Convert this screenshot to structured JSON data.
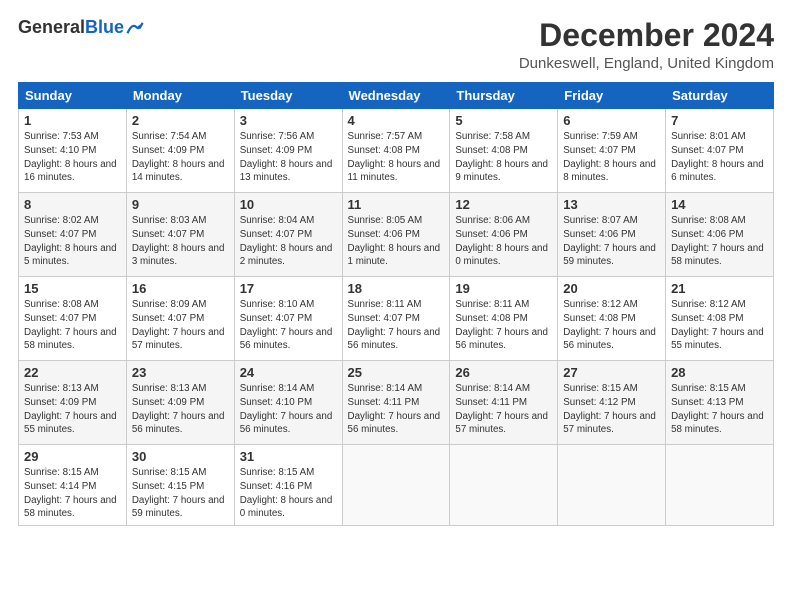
{
  "logo": {
    "general": "General",
    "blue": "Blue"
  },
  "header": {
    "month": "December 2024",
    "location": "Dunkeswell, England, United Kingdom"
  },
  "weekdays": [
    "Sunday",
    "Monday",
    "Tuesday",
    "Wednesday",
    "Thursday",
    "Friday",
    "Saturday"
  ],
  "weeks": [
    [
      {
        "day": "1",
        "sunrise": "7:53 AM",
        "sunset": "4:10 PM",
        "daylight": "8 hours and 16 minutes."
      },
      {
        "day": "2",
        "sunrise": "7:54 AM",
        "sunset": "4:09 PM",
        "daylight": "8 hours and 14 minutes."
      },
      {
        "day": "3",
        "sunrise": "7:56 AM",
        "sunset": "4:09 PM",
        "daylight": "8 hours and 13 minutes."
      },
      {
        "day": "4",
        "sunrise": "7:57 AM",
        "sunset": "4:08 PM",
        "daylight": "8 hours and 11 minutes."
      },
      {
        "day": "5",
        "sunrise": "7:58 AM",
        "sunset": "4:08 PM",
        "daylight": "8 hours and 9 minutes."
      },
      {
        "day": "6",
        "sunrise": "7:59 AM",
        "sunset": "4:07 PM",
        "daylight": "8 hours and 8 minutes."
      },
      {
        "day": "7",
        "sunrise": "8:01 AM",
        "sunset": "4:07 PM",
        "daylight": "8 hours and 6 minutes."
      }
    ],
    [
      {
        "day": "8",
        "sunrise": "8:02 AM",
        "sunset": "4:07 PM",
        "daylight": "8 hours and 5 minutes."
      },
      {
        "day": "9",
        "sunrise": "8:03 AM",
        "sunset": "4:07 PM",
        "daylight": "8 hours and 3 minutes."
      },
      {
        "day": "10",
        "sunrise": "8:04 AM",
        "sunset": "4:07 PM",
        "daylight": "8 hours and 2 minutes."
      },
      {
        "day": "11",
        "sunrise": "8:05 AM",
        "sunset": "4:06 PM",
        "daylight": "8 hours and 1 minute."
      },
      {
        "day": "12",
        "sunrise": "8:06 AM",
        "sunset": "4:06 PM",
        "daylight": "8 hours and 0 minutes."
      },
      {
        "day": "13",
        "sunrise": "8:07 AM",
        "sunset": "4:06 PM",
        "daylight": "7 hours and 59 minutes."
      },
      {
        "day": "14",
        "sunrise": "8:08 AM",
        "sunset": "4:06 PM",
        "daylight": "7 hours and 58 minutes."
      }
    ],
    [
      {
        "day": "15",
        "sunrise": "8:08 AM",
        "sunset": "4:07 PM",
        "daylight": "7 hours and 58 minutes."
      },
      {
        "day": "16",
        "sunrise": "8:09 AM",
        "sunset": "4:07 PM",
        "daylight": "7 hours and 57 minutes."
      },
      {
        "day": "17",
        "sunrise": "8:10 AM",
        "sunset": "4:07 PM",
        "daylight": "7 hours and 56 minutes."
      },
      {
        "day": "18",
        "sunrise": "8:11 AM",
        "sunset": "4:07 PM",
        "daylight": "7 hours and 56 minutes."
      },
      {
        "day": "19",
        "sunrise": "8:11 AM",
        "sunset": "4:08 PM",
        "daylight": "7 hours and 56 minutes."
      },
      {
        "day": "20",
        "sunrise": "8:12 AM",
        "sunset": "4:08 PM",
        "daylight": "7 hours and 56 minutes."
      },
      {
        "day": "21",
        "sunrise": "8:12 AM",
        "sunset": "4:08 PM",
        "daylight": "7 hours and 55 minutes."
      }
    ],
    [
      {
        "day": "22",
        "sunrise": "8:13 AM",
        "sunset": "4:09 PM",
        "daylight": "7 hours and 55 minutes."
      },
      {
        "day": "23",
        "sunrise": "8:13 AM",
        "sunset": "4:09 PM",
        "daylight": "7 hours and 56 minutes."
      },
      {
        "day": "24",
        "sunrise": "8:14 AM",
        "sunset": "4:10 PM",
        "daylight": "7 hours and 56 minutes."
      },
      {
        "day": "25",
        "sunrise": "8:14 AM",
        "sunset": "4:11 PM",
        "daylight": "7 hours and 56 minutes."
      },
      {
        "day": "26",
        "sunrise": "8:14 AM",
        "sunset": "4:11 PM",
        "daylight": "7 hours and 57 minutes."
      },
      {
        "day": "27",
        "sunrise": "8:15 AM",
        "sunset": "4:12 PM",
        "daylight": "7 hours and 57 minutes."
      },
      {
        "day": "28",
        "sunrise": "8:15 AM",
        "sunset": "4:13 PM",
        "daylight": "7 hours and 58 minutes."
      }
    ],
    [
      {
        "day": "29",
        "sunrise": "8:15 AM",
        "sunset": "4:14 PM",
        "daylight": "7 hours and 58 minutes."
      },
      {
        "day": "30",
        "sunrise": "8:15 AM",
        "sunset": "4:15 PM",
        "daylight": "7 hours and 59 minutes."
      },
      {
        "day": "31",
        "sunrise": "8:15 AM",
        "sunset": "4:16 PM",
        "daylight": "8 hours and 0 minutes."
      },
      null,
      null,
      null,
      null
    ]
  ]
}
